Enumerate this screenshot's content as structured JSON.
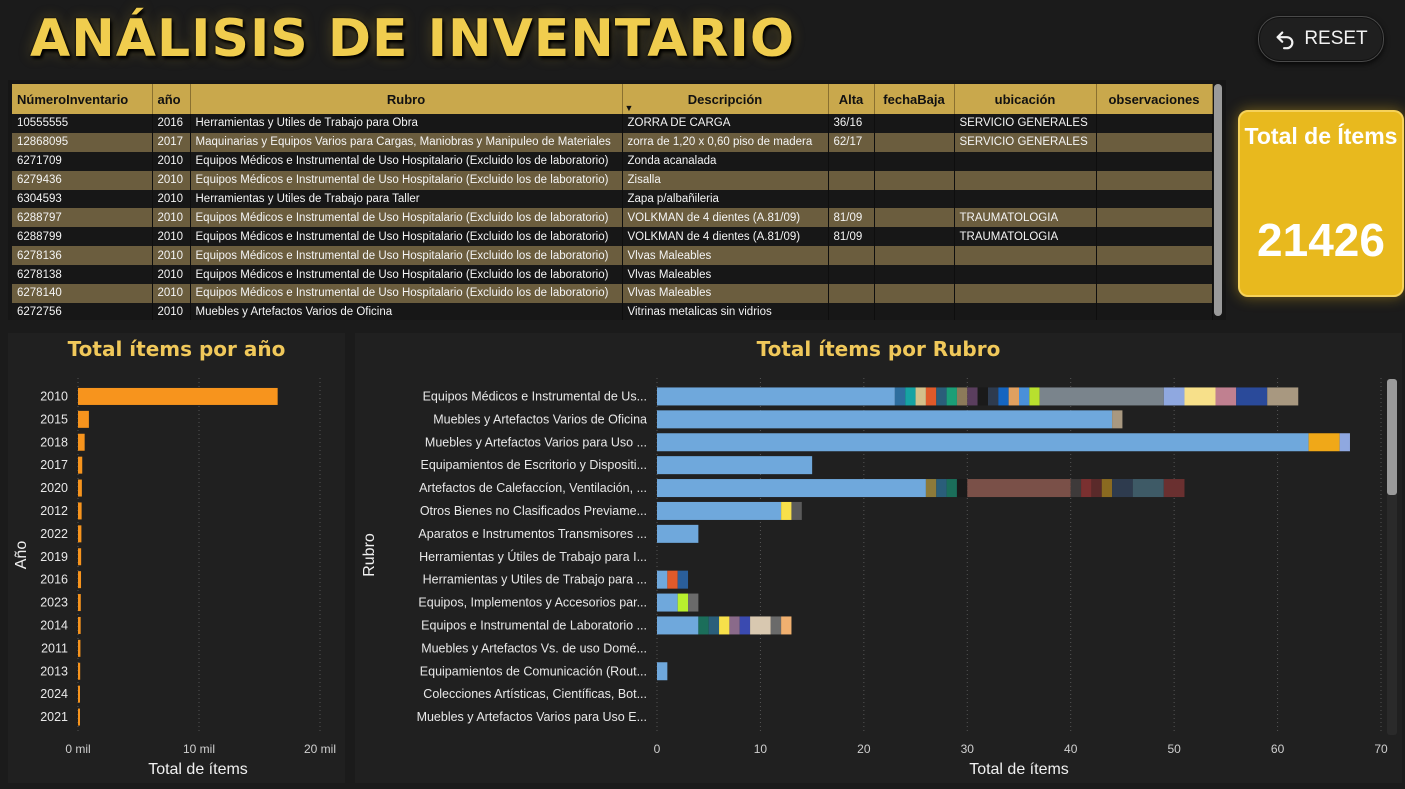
{
  "header": {
    "title": "ANÁLISIS DE INVENTARIO",
    "reset_label": "RESET"
  },
  "kpi": {
    "label": "Total de Ítems",
    "value": "21426"
  },
  "table": {
    "columns": [
      "NúmeroInventario",
      "año",
      "Rubro",
      "Descripción",
      "Alta",
      "fechaBaja",
      "ubicación",
      "observaciones"
    ],
    "rows": [
      [
        "10555555",
        "2016",
        "Herramientas y Utiles de Trabajo para Obra",
        "ZORRA DE CARGA",
        "36/16",
        "",
        "SERVICIO GENERALES",
        ""
      ],
      [
        "12868095",
        "2017",
        "Maquinarias y Equipos Varios para Cargas, Maniobras y Manipuleo de Materiales",
        "zorra de 1,20 x 0,60 piso de madera",
        "62/17",
        "",
        "SERVICIO GENERALES",
        ""
      ],
      [
        "6271709",
        "2010",
        "Equipos Médicos e Instrumental de Uso Hospitalario (Excluido los de laboratorio)",
        "Zonda acanalada",
        "",
        "",
        "",
        ""
      ],
      [
        "6279436",
        "2010",
        "Equipos Médicos e Instrumental de Uso Hospitalario (Excluido los de laboratorio)",
        "Zisalla",
        "",
        "",
        "",
        ""
      ],
      [
        "6304593",
        "2010",
        "Herramientas y Utiles de Trabajo para Taller",
        "Zapa p/albañileria",
        "",
        "",
        "",
        ""
      ],
      [
        "6288797",
        "2010",
        "Equipos Médicos e Instrumental de Uso Hospitalario (Excluido los de laboratorio)",
        "VOLKMAN de 4 dientes (A.81/09)",
        "81/09",
        "",
        "TRAUMATOLOGIA",
        ""
      ],
      [
        "6288799",
        "2010",
        "Equipos Médicos e Instrumental de Uso Hospitalario (Excluido los de laboratorio)",
        "VOLKMAN de 4 dientes (A.81/09)",
        "81/09",
        "",
        "TRAUMATOLOGIA",
        ""
      ],
      [
        "6278136",
        "2010",
        "Equipos Médicos e Instrumental de Uso Hospitalario (Excluido los de laboratorio)",
        "Vlvas Maleables",
        "",
        "",
        "",
        ""
      ],
      [
        "6278138",
        "2010",
        "Equipos Médicos e Instrumental de Uso Hospitalario (Excluido los de laboratorio)",
        "Vlvas Maleables",
        "",
        "",
        "",
        ""
      ],
      [
        "6278140",
        "2010",
        "Equipos Médicos e Instrumental de Uso Hospitalario (Excluido los de laboratorio)",
        "Vlvas Maleables",
        "",
        "",
        "",
        ""
      ],
      [
        "6272756",
        "2010",
        "Muebles y Artefactos Varios de Oficina",
        "Vitrinas metalicas sin vidrios",
        "",
        "",
        "",
        ""
      ]
    ]
  },
  "chart_data": [
    {
      "type": "bar",
      "orientation": "horizontal",
      "title": "Total ítems por año",
      "xlabel": "Total de ítems",
      "ylabel": "Año",
      "categories": [
        "2010",
        "2015",
        "2018",
        "2017",
        "2020",
        "2012",
        "2022",
        "2019",
        "2016",
        "2023",
        "2014",
        "2011",
        "2013",
        "2024",
        "2021"
      ],
      "values": [
        16500,
        900,
        550,
        350,
        320,
        300,
        280,
        260,
        250,
        230,
        220,
        200,
        180,
        160,
        150
      ],
      "xlim": [
        0,
        20000
      ],
      "xticks": [
        "0 mil",
        "10 mil",
        "20 mil"
      ],
      "color": "#f7941d",
      "grid": true
    },
    {
      "type": "bar",
      "orientation": "horizontal",
      "stacked": true,
      "title": "Total ítems por Rubro",
      "xlabel": "Total de ítems",
      "ylabel": "Rubro",
      "categories": [
        "Equipos Médicos e Instrumental de Us...",
        "Muebles y Artefactos Varios de Oficina",
        "Muebles y Artefactos Varios para Uso ...",
        "Equipamientos de Escritorio y Dispositi...",
        "Artefactos de Calefaccíon, Ventilación, ...",
        "Otros Bienes no Clasificados Previame...",
        "Aparatos e Instrumentos Transmisores ...",
        "Herramientas y Útiles de Trabajo para I...",
        "Herramientas y Utiles de Trabajo para ...",
        "Equipos, Implementos y Accesorios par...",
        "Equipos e Instrumental de Laboratorio ...",
        "Muebles y Artefactos Vs. de uso Domé...",
        "Equipamientos de Comunicación (Rout...",
        "Colecciones Artísticas, Científicas, Bot...",
        "Muebles y Artefactos Varios para Uso E..."
      ],
      "segments": [
        [
          [
            23,
            "#6fa8dc"
          ],
          [
            1,
            "#2e6e9e"
          ],
          [
            1,
            "#16a3a3"
          ],
          [
            1,
            "#d4c08a"
          ],
          [
            1,
            "#e05a2a"
          ],
          [
            1,
            "#2a5e7a"
          ],
          [
            1,
            "#1b9e77"
          ],
          [
            1,
            "#8c7a5a"
          ],
          [
            1,
            "#5a3e5e"
          ],
          [
            1,
            "#1a1a1a"
          ],
          [
            1,
            "#2e3b4e"
          ],
          [
            1,
            "#1565c0"
          ],
          [
            1,
            "#e0a060"
          ],
          [
            1,
            "#4a90d9"
          ],
          [
            1,
            "#b8e02e"
          ],
          [
            12,
            "#7a848c"
          ],
          [
            2,
            "#8fa8e0"
          ],
          [
            3,
            "#f7e08a"
          ],
          [
            2,
            "#c08090"
          ],
          [
            3,
            "#2a4a9a"
          ],
          [
            3,
            "#a89880"
          ]
        ],
        [
          [
            44,
            "#6fa8dc"
          ],
          [
            1,
            "#a89880"
          ]
        ],
        [
          [
            63,
            "#6fa8dc"
          ],
          [
            3,
            "#f0a818"
          ],
          [
            1,
            "#8fa8e0"
          ]
        ],
        [
          [
            15,
            "#6fa8dc"
          ]
        ],
        [
          [
            26,
            "#6fa8dc"
          ],
          [
            1,
            "#8c7a3a"
          ],
          [
            1,
            "#2a5e7a"
          ],
          [
            1,
            "#1b6e5a"
          ],
          [
            1,
            "#1a1a1a"
          ],
          [
            10,
            "#7a5048"
          ],
          [
            1,
            "#3e3a3a"
          ],
          [
            1,
            "#7a3030"
          ],
          [
            1,
            "#5a2a2a"
          ],
          [
            1,
            "#8a6a20"
          ],
          [
            2,
            "#2e3b4e"
          ],
          [
            3,
            "#3e5a66"
          ],
          [
            2,
            "#6a3030"
          ]
        ],
        [
          [
            12,
            "#6fa8dc"
          ],
          [
            1,
            "#f7e04a"
          ],
          [
            1,
            "#5a5a5a"
          ]
        ],
        [
          [
            4,
            "#6fa8dc"
          ]
        ],
        [],
        [
          [
            1,
            "#6fa8dc"
          ],
          [
            1,
            "#e05a2a"
          ],
          [
            1,
            "#2a5e9a"
          ]
        ],
        [
          [
            2,
            "#6fa8dc"
          ],
          [
            1,
            "#b8f02e"
          ],
          [
            1,
            "#6a6a6a"
          ]
        ],
        [
          [
            4,
            "#6fa8dc"
          ],
          [
            1,
            "#1b6e5a"
          ],
          [
            1,
            "#2a5e7a"
          ],
          [
            1,
            "#f7e04a"
          ],
          [
            1,
            "#8a6a8a"
          ],
          [
            1,
            "#3a4ab0"
          ],
          [
            2,
            "#d8c8b0"
          ],
          [
            1,
            "#6a6a6a"
          ],
          [
            1,
            "#f0b070"
          ]
        ],
        [],
        [
          [
            1,
            "#6fa8dc"
          ]
        ],
        [],
        []
      ],
      "xlim": [
        0,
        70
      ],
      "xticks": [
        0,
        10,
        20,
        30,
        40,
        50,
        60,
        70
      ],
      "grid": true
    }
  ]
}
